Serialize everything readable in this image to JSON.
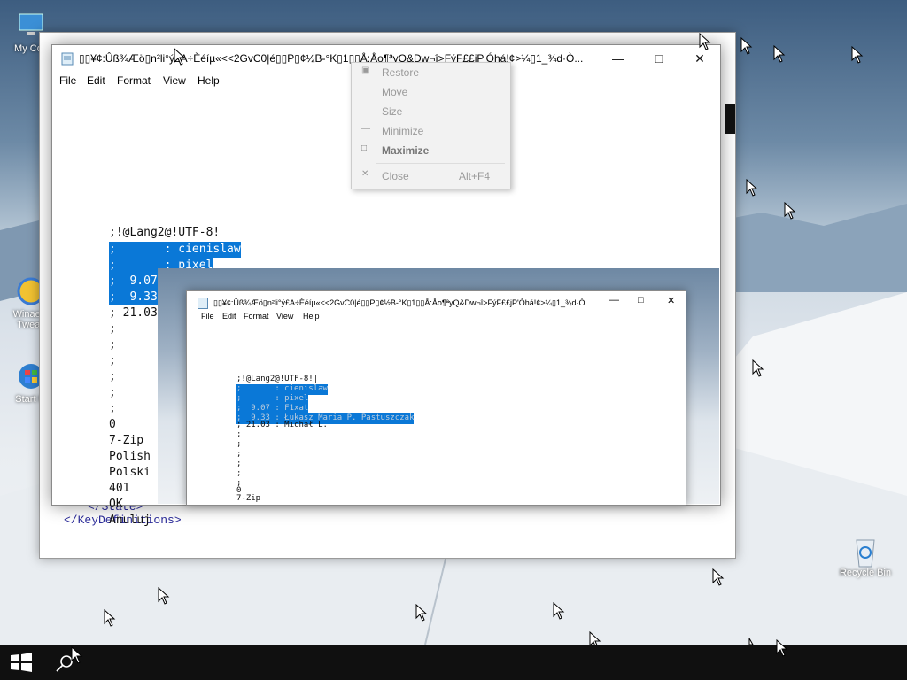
{
  "desktop": {
    "icons": [
      {
        "label": "My Con"
      },
      {
        "label": "Winaero Tweak"
      },
      {
        "label": "Start M"
      },
      {
        "label": "Recycle Bin"
      }
    ]
  },
  "back_window": {
    "xml_lines": [
      "</State>",
      "</KeyDefinitions>"
    ]
  },
  "notepad": {
    "title": "▯▯¥¢:Ûß¾Æö▯n²li°ý£A÷Èéíµ«<<2GvC0|é▯▯P▯¢½B-°K▯1▯▯Å:Åo¶ªyQ&Dw¬î>FýF££jP'Óhá!¢>¼▯1_¾d·Ò...",
    "menu": [
      "File",
      "Edit",
      "Format",
      "View",
      "Help"
    ],
    "lines": [
      {
        "text": ";!@Lang2@!UTF-8!",
        "selected": false
      },
      {
        "text": ";       : cienislaw",
        "selected": true
      },
      {
        "text": ";       : pixel",
        "selected": true
      },
      {
        "text": ";  9.07 : F1xat",
        "selected": true
      },
      {
        "text": ";  9.33 : Łukasz Maria P. Pastuszczak",
        "selected": true
      },
      {
        "text": "; 21.03 : Michał L.",
        "selected": false
      },
      {
        "text": ";",
        "selected": false
      },
      {
        "text": ";",
        "selected": false
      },
      {
        "text": ";",
        "selected": false
      },
      {
        "text": ";",
        "selected": false
      },
      {
        "text": ";",
        "selected": false
      },
      {
        "text": ";",
        "selected": false
      },
      {
        "text": "0",
        "selected": false
      },
      {
        "text": "7-Zip",
        "selected": false
      },
      {
        "text": "Polish",
        "selected": false
      },
      {
        "text": "Polski",
        "selected": false
      },
      {
        "text": "401",
        "selected": false
      },
      {
        "text": "OK",
        "selected": false
      },
      {
        "text": "Anuluj",
        "selected": false
      }
    ]
  },
  "system_menu": {
    "items": [
      {
        "label": "Restore",
        "glyph": "▣",
        "accel": ""
      },
      {
        "label": "Move",
        "glyph": "",
        "accel": ""
      },
      {
        "label": "Size",
        "glyph": "",
        "accel": ""
      },
      {
        "label": "Minimize",
        "glyph": "—",
        "accel": ""
      },
      {
        "label": "Maximize",
        "glyph": "□",
        "accel": ""
      },
      {
        "label": "Close",
        "glyph": "✕",
        "accel": "Alt+F4"
      }
    ]
  },
  "nested_notepad": {
    "title": "▯▯¥¢:Ûß¾Æö▯n²li°ý£A÷Èéíµ«<<2GvC0|é▯▯P▯¢½B-°K▯1▯▯Å:Åo¶ªyQ&Dw¬î>FýF££jP'Óhá!¢>¼▯1_¾d·Ò...",
    "menu": [
      "File",
      "Edit",
      "Format",
      "View",
      "Help"
    ],
    "lines": [
      {
        "text": ";!@Lang2@!UTF-8!|",
        "selected": false
      },
      {
        "text": ";       : cienislaw",
        "selected": true
      },
      {
        "text": ";       : pixel",
        "selected": true
      },
      {
        "text": ";  9.07 : F1xat",
        "selected": true
      },
      {
        "text": ";  9.33 : Łukasz Maria P. Pastuszczak",
        "selected": true
      },
      {
        "text": "; 21.03 : Michał L.",
        "selected": false
      },
      {
        "text": ";",
        "selected": false
      },
      {
        "text": ";",
        "selected": false
      },
      {
        "text": ";",
        "selected": false
      },
      {
        "text": ";",
        "selected": false
      },
      {
        "text": ";",
        "selected": false
      },
      {
        "text": ";",
        "selected": false
      },
      {
        "text": "0",
        "selected": false
      },
      {
        "text": "7-Zip",
        "selected": false
      }
    ]
  },
  "colors": {
    "selection": "#0a78d7",
    "taskbar": "#101010"
  }
}
